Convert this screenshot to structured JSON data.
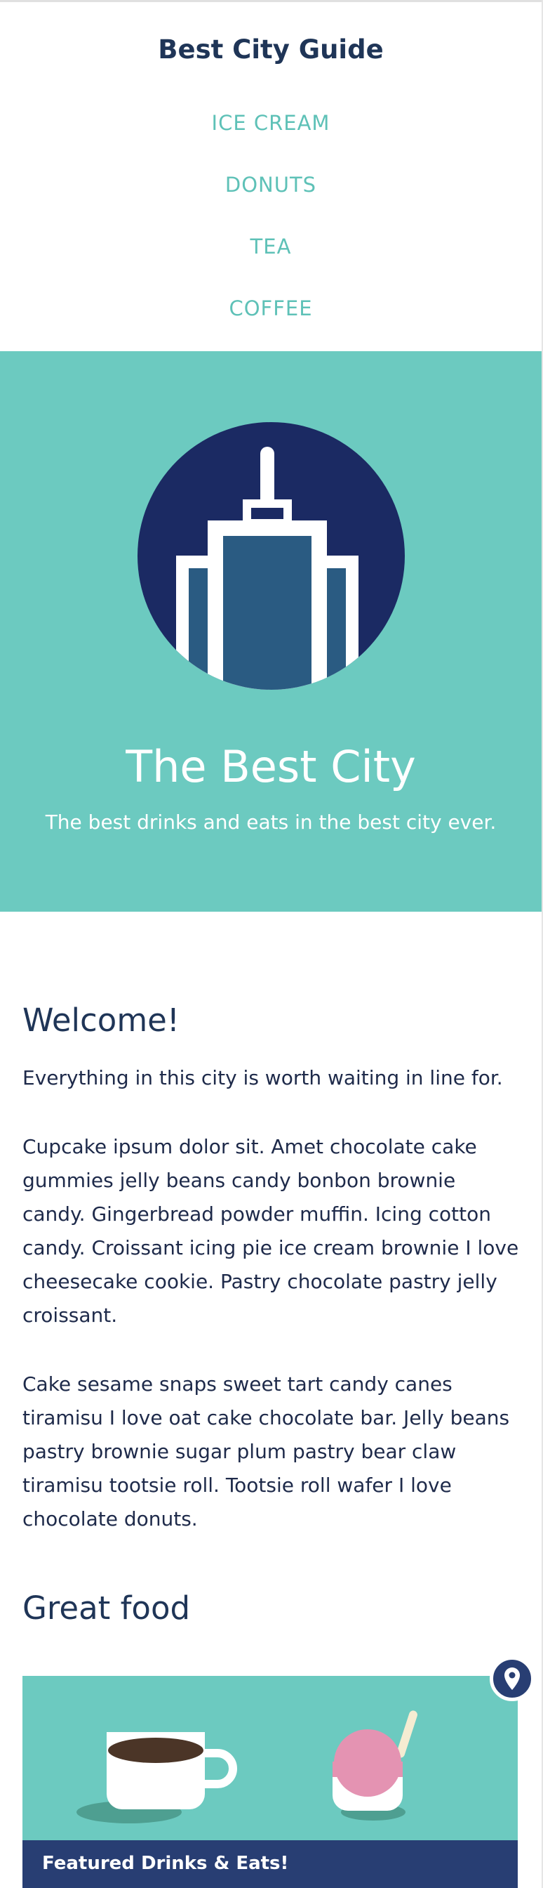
{
  "header": {
    "brand": "Best City Guide",
    "nav": [
      "ICE CREAM",
      "DONUTS",
      "TEA",
      "COFFEE"
    ]
  },
  "hero": {
    "title": "The Best City",
    "subtitle": "The best drinks and eats in the best city ever.",
    "icon": "city-skyline-icon"
  },
  "welcome": {
    "heading": "Welcome!",
    "tagline": "Everything in this city is worth waiting in line for.",
    "paragraphs": [
      "Cupcake ipsum dolor sit. Amet chocolate cake gummies jelly beans candy bonbon brownie candy. Gingerbread powder muffin. Icing cotton candy. Croissant icing pie ice cream brownie I love cheesecake cookie. Pastry chocolate pastry jelly croissant.",
      "Cake sesame snaps sweet tart candy canes tiramisu I love oat cake chocolate bar. Jelly beans pastry brownie sugar plum pastry bear claw tiramisu tootsie roll. Tootsie roll wafer I love chocolate donuts."
    ]
  },
  "food": {
    "heading": "Great food",
    "card_label": "Featured Drinks & Eats!",
    "icons": [
      "coffee-cup-icon",
      "ice-cream-cup-icon",
      "map-pin-icon"
    ]
  },
  "colors": {
    "teal": "#6ccac0",
    "navy": "#1f3557",
    "dark_blue": "#283e73",
    "circle_blue": "#1b2a63",
    "building_blue": "#2a5b82",
    "nav_teal": "#5ec1b7"
  }
}
